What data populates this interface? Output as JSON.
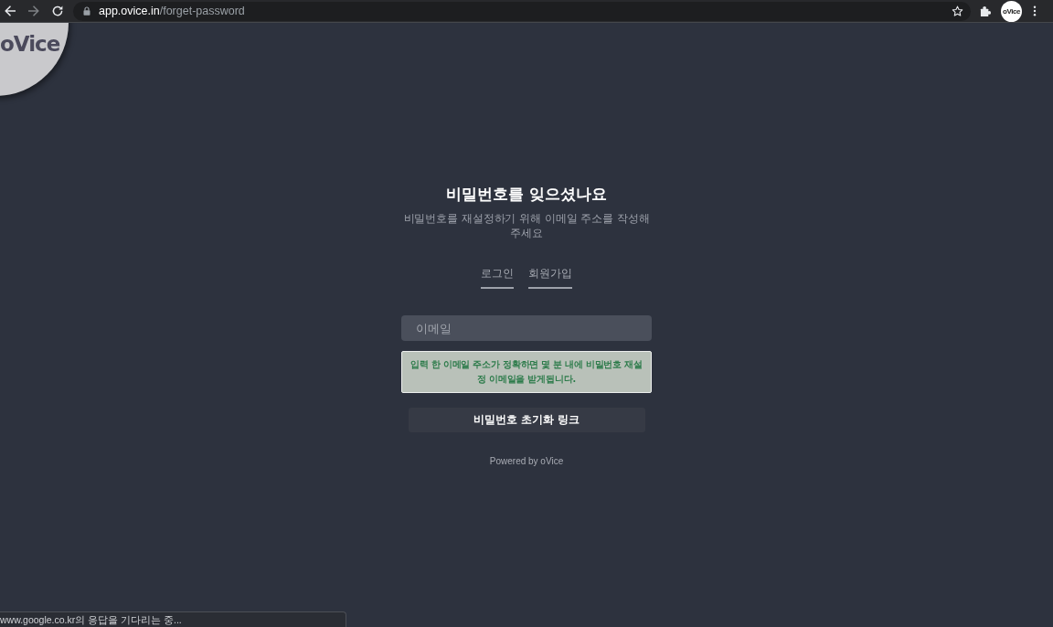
{
  "browser": {
    "nav_buttons": [
      {
        "kind": "back",
        "disabled": false
      },
      {
        "kind": "forward",
        "disabled": true
      },
      {
        "kind": "reload",
        "disabled": false
      }
    ],
    "url": {
      "host": "app.ovice.in",
      "path": "/forget-password"
    },
    "profile_avatar": "oVice"
  },
  "logo": {
    "text": "oVice"
  },
  "form": {
    "title": "비밀번호를 잊으셨나요",
    "subtitle": "비밀번호를 재설정하기 위해 이메일 주소를 작성해주세요",
    "tabs": [
      {
        "label": "로그인",
        "selected": false
      },
      {
        "label": "회원가입",
        "selected": false
      }
    ],
    "email_field": {
      "placeholder": "이메일"
    },
    "notice": "입력 한 이메일 주소가 정확하면 몇 분 내에 비밀번호 재설정 이메일을 받게됩니다.",
    "submit_button": "비밀번호 초기화 링크",
    "footer": "Powered by oVice"
  },
  "status_bubble": "www.google.co.kr의 응답을 기다리는 중..."
}
